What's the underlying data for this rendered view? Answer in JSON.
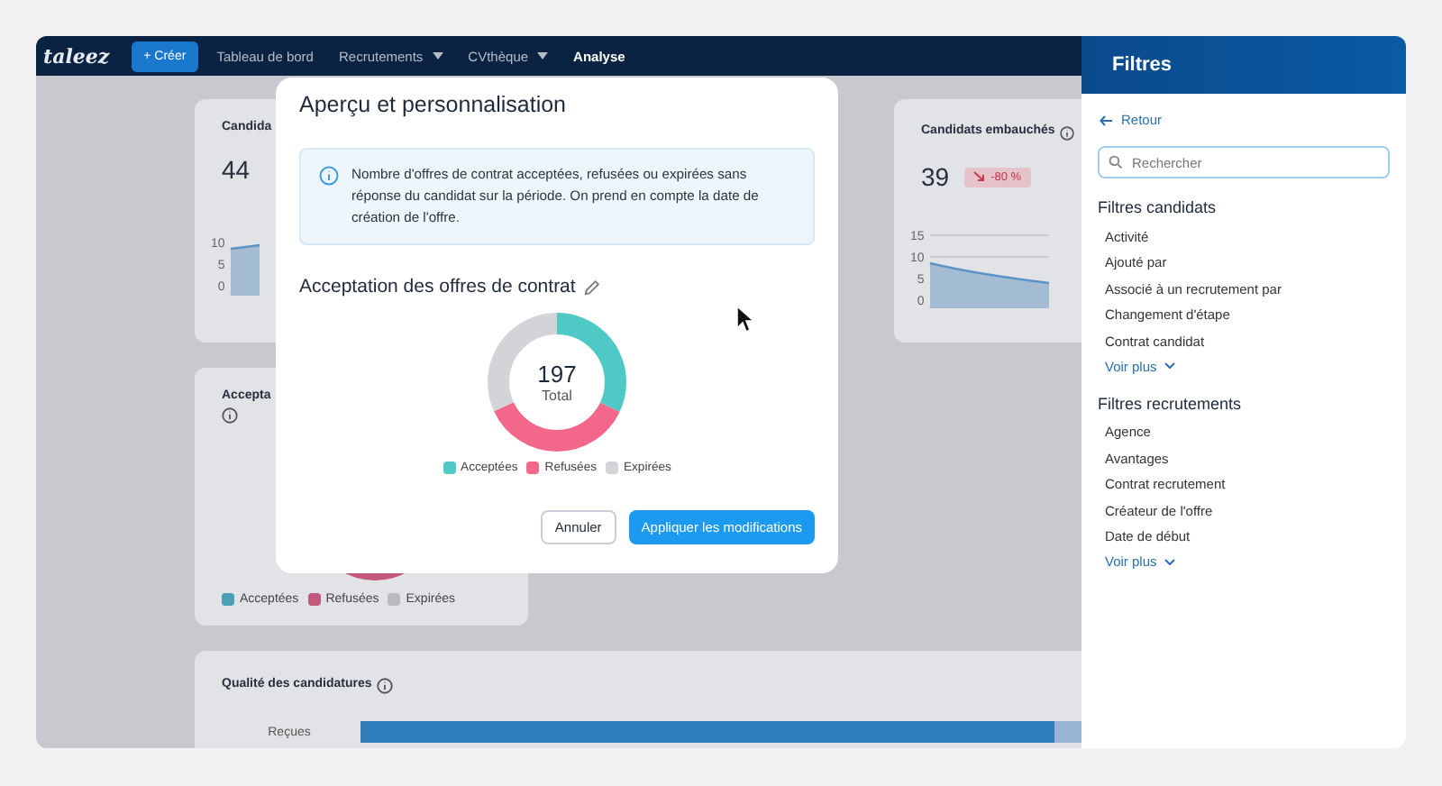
{
  "nav": {
    "logo": "taleez",
    "create_button": "+ Créer",
    "items": [
      {
        "label": "Tableau de bord",
        "dropdown": false,
        "selected": false
      },
      {
        "label": "Recrutements",
        "dropdown": true,
        "selected": false
      },
      {
        "label": "CVthèque",
        "dropdown": true,
        "selected": false
      },
      {
        "label": "Analyse",
        "dropdown": false,
        "selected": true
      }
    ]
  },
  "dashboard": {
    "cards": [
      {
        "title": "Candida",
        "value": "44",
        "axis_labels": [
          "10",
          "5",
          "0"
        ]
      },
      {
        "title": "Candidats embauchés",
        "value": "39",
        "badge": "-80 %",
        "axis_labels": [
          "15",
          "10",
          "5",
          "0"
        ]
      }
    ],
    "acceptance_card": {
      "title": "Accepta",
      "legend": [
        {
          "label": "Acceptées",
          "color": "#4a9fb4"
        },
        {
          "label": "Refusées",
          "color": "#c2597a"
        },
        {
          "label": "Expirées",
          "color": "#b9babf"
        }
      ]
    },
    "quality_card": {
      "title": "Qualité des candidatures",
      "row_label": "Reçues"
    }
  },
  "modal": {
    "title": "Aperçu et personnalisation",
    "info": "Nombre d'offres de contrat acceptées, refusées ou expirées sans réponse du candidat sur la période. On prend en compte la date de création de l'offre.",
    "chart_title": "Acceptation des offres de contrat",
    "total": "197",
    "total_label": "Total",
    "legend": [
      {
        "label": "Acceptées",
        "color": "#4ec9c6"
      },
      {
        "label": "Refusées",
        "color": "#f2678a"
      },
      {
        "label": "Expirées",
        "color": "#d3d4d8"
      }
    ],
    "buttons": [
      {
        "label": "Annuler",
        "kind": "secondary"
      },
      {
        "label": "Appliquer les modifications",
        "kind": "primary"
      }
    ]
  },
  "filters": {
    "title": "Filtres",
    "back": "Retour",
    "search": {
      "placeholder": "Rechercher"
    },
    "sections": [
      {
        "title": "Filtres candidats",
        "items": [
          "Activité",
          "Ajouté par",
          "Associé à un recrutement par",
          "Changement d'étape",
          "Contrat candidat"
        ],
        "more": "Voir plus"
      },
      {
        "title": "Filtres recrutements",
        "items": [
          "Agence",
          "Avantages",
          "Contrat recrutement",
          "Créateur de l'offre",
          "Date de début"
        ],
        "more": "Voir plus"
      }
    ]
  }
}
